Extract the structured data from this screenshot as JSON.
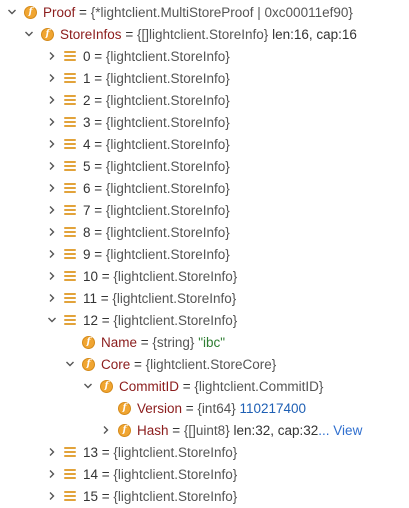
{
  "tree": {
    "proof": {
      "name": "Proof",
      "type": "{*lightclient.MultiStoreProof | 0xc00011ef90}"
    },
    "store_infos": {
      "name": "StoreInfos",
      "type": "{[]lightclient.StoreInfo}",
      "meta": "len:16, cap:16"
    },
    "items_before": [
      {
        "name": "0",
        "type": "{lightclient.StoreInfo}"
      },
      {
        "name": "1",
        "type": "{lightclient.StoreInfo}"
      },
      {
        "name": "2",
        "type": "{lightclient.StoreInfo}"
      },
      {
        "name": "3",
        "type": "{lightclient.StoreInfo}"
      },
      {
        "name": "4",
        "type": "{lightclient.StoreInfo}"
      },
      {
        "name": "5",
        "type": "{lightclient.StoreInfo}"
      },
      {
        "name": "6",
        "type": "{lightclient.StoreInfo}"
      },
      {
        "name": "7",
        "type": "{lightclient.StoreInfo}"
      },
      {
        "name": "8",
        "type": "{lightclient.StoreInfo}"
      },
      {
        "name": "9",
        "type": "{lightclient.StoreInfo}"
      },
      {
        "name": "10",
        "type": "{lightclient.StoreInfo}"
      },
      {
        "name": "11",
        "type": "{lightclient.StoreInfo}"
      }
    ],
    "item_12": {
      "name": "12",
      "type": "{lightclient.StoreInfo}"
    },
    "name_field": {
      "name": "Name",
      "type": "{string}",
      "value": "\"ibc\""
    },
    "core_field": {
      "name": "Core",
      "type": "{lightclient.StoreCore}"
    },
    "commit_id": {
      "name": "CommitID",
      "type": "{lightclient.CommitID}"
    },
    "version": {
      "name": "Version",
      "type": "{int64}",
      "value": "110217400"
    },
    "hash": {
      "name": "Hash",
      "type": "{[]uint8}",
      "meta": "len:32, cap:32",
      "link": "... View"
    },
    "items_after": [
      {
        "name": "13",
        "type": "{lightclient.StoreInfo}"
      },
      {
        "name": "14",
        "type": "{lightclient.StoreInfo}"
      },
      {
        "name": "15",
        "type": "{lightclient.StoreInfo}"
      }
    ],
    "equals": "=",
    "icons": {
      "field": "field-icon",
      "struct": "struct-icon",
      "expand": "chevron-down-icon",
      "collapse": "chevron-right-icon"
    },
    "colors": {
      "field_icon": "#f0a531",
      "struct_icon": "#e2a33a",
      "name": "#8b1c1c",
      "string_value": "#2e7d32",
      "number_value": "#1e5fb4",
      "link": "#2f6fcf"
    }
  }
}
